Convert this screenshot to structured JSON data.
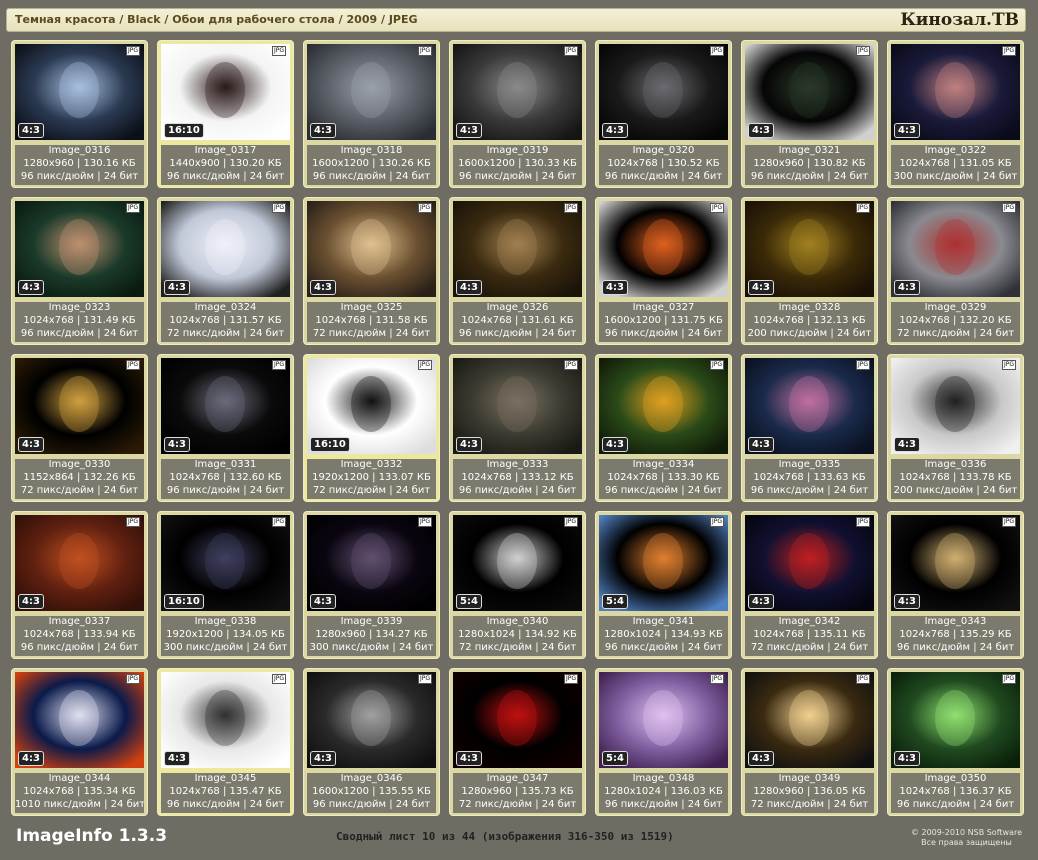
{
  "breadcrumb": "Темная красота / Black / Обои для рабочего стола / 2009 / JPEG",
  "brand": "Кинозал.ТВ",
  "format_badge": "JPG",
  "footer": {
    "app_name": "ImageInfo 1.3.3",
    "summary": "Сводный лист 10 из 44 (изображения 316-350 из 1519)",
    "copyright": "© 2009-2010 NSB Software",
    "rights": "Все права защищены"
  },
  "thumbnails": [
    {
      "name": "Image_0316",
      "ratio": "4:3",
      "dims": "1280x960 | 130.16 КБ",
      "meta": "96 пикс/дюйм | 24 бит",
      "colors": [
        "#2b3a52",
        "#a8c0e0",
        "#0a0f18"
      ]
    },
    {
      "name": "Image_0317",
      "ratio": "16:10",
      "dims": "1440x900 | 130.20 КБ",
      "meta": "96 пикс/дюйм | 24 бит",
      "colors": [
        "#f4f4f4",
        "#2a1a1a",
        "#ffffff"
      ],
      "selected": true
    },
    {
      "name": "Image_0318",
      "ratio": "4:3",
      "dims": "1600x1200 | 130.26 КБ",
      "meta": "96 пикс/дюйм | 24 бит",
      "colors": [
        "#5a5e66",
        "#9aa0a8",
        "#2a2d33"
      ]
    },
    {
      "name": "Image_0319",
      "ratio": "4:3",
      "dims": "1600x1200 | 130.33 КБ",
      "meta": "96 пикс/дюйм | 24 бит",
      "colors": [
        "#3a3a3a",
        "#8a8a8a",
        "#151515"
      ]
    },
    {
      "name": "Image_0320",
      "ratio": "4:3",
      "dims": "1024x768 | 130.52 КБ",
      "meta": "96 пикс/дюйм | 24 бит",
      "colors": [
        "#1a1a1a",
        "#6a6a70",
        "#050505"
      ]
    },
    {
      "name": "Image_0321",
      "ratio": "4:3",
      "dims": "1280x960 | 130.82 КБ",
      "meta": "96 пикс/дюйм | 24 бит",
      "colors": [
        "#050505",
        "#2a3a2a",
        "#d0d0d0"
      ]
    },
    {
      "name": "Image_0322",
      "ratio": "4:3",
      "dims": "1024x768 | 131.05 КБ",
      "meta": "300 пикс/дюйм | 24 бит",
      "colors": [
        "#1a1a3a",
        "#c08080",
        "#0a0a1a"
      ]
    },
    {
      "name": "Image_0323",
      "ratio": "4:3",
      "dims": "1024x768 | 131.49 КБ",
      "meta": "96 пикс/дюйм | 24 бит",
      "colors": [
        "#1a3a2a",
        "#c09070",
        "#0a1a10"
      ]
    },
    {
      "name": "Image_0324",
      "ratio": "4:3",
      "dims": "1024x768 | 131.57 КБ",
      "meta": "72 пикс/дюйм | 24 бит",
      "colors": [
        "#c0c8d8",
        "#f0f0f8",
        "#202020"
      ]
    },
    {
      "name": "Image_0325",
      "ratio": "4:3",
      "dims": "1024x768 | 131.58 КБ",
      "meta": "72 пикс/дюйм | 24 бит",
      "colors": [
        "#6a5030",
        "#e0c090",
        "#2a2018"
      ]
    },
    {
      "name": "Image_0326",
      "ratio": "4:3",
      "dims": "1024x768 | 131.61 КБ",
      "meta": "96 пикс/дюйм | 24 бит",
      "colors": [
        "#3a2a10",
        "#a08050",
        "#1a1408"
      ]
    },
    {
      "name": "Image_0327",
      "ratio": "4:3",
      "dims": "1600x1200 | 131.75 КБ",
      "meta": "96 пикс/дюйм | 24 бит",
      "colors": [
        "#000000",
        "#e06020",
        "#d0d0d0"
      ]
    },
    {
      "name": "Image_0328",
      "ratio": "4:3",
      "dims": "1024x768 | 132.13 КБ",
      "meta": "200 пикс/дюйм | 24 бит",
      "colors": [
        "#3a2a08",
        "#a08020",
        "#1a1005"
      ]
    },
    {
      "name": "Image_0329",
      "ratio": "4:3",
      "dims": "1024x768 | 132.20 КБ",
      "meta": "72 пикс/дюйм | 24 бит",
      "colors": [
        "#8a8a90",
        "#b03030",
        "#303038"
      ]
    },
    {
      "name": "Image_0330",
      "ratio": "4:3",
      "dims": "1152x864 | 132.26 КБ",
      "meta": "72 пикс/дюйм | 24 бит",
      "colors": [
        "#000000",
        "#d0a040",
        "#2a1a05"
      ]
    },
    {
      "name": "Image_0331",
      "ratio": "4:3",
      "dims": "1024x768 | 132.60 КБ",
      "meta": "96 пикс/дюйм | 24 бит",
      "colors": [
        "#0a0a0a",
        "#6a6a7a",
        "#000000"
      ]
    },
    {
      "name": "Image_0332",
      "ratio": "16:10",
      "dims": "1920x1200 | 133.07 КБ",
      "meta": "72 пикс/дюйм | 24 бит",
      "colors": [
        "#ffffff",
        "#111111",
        "#dddddd"
      ],
      "selected": true
    },
    {
      "name": "Image_0333",
      "ratio": "4:3",
      "dims": "1024x768 | 133.12 КБ",
      "meta": "96 пикс/дюйм | 24 бит",
      "colors": [
        "#3a3a30",
        "#7a7060",
        "#1a1a15"
      ]
    },
    {
      "name": "Image_0334",
      "ratio": "4:3",
      "dims": "1024x768 | 133.30 КБ",
      "meta": "96 пикс/дюйм | 24 бит",
      "colors": [
        "#2a4a18",
        "#e0a020",
        "#101a08"
      ]
    },
    {
      "name": "Image_0335",
      "ratio": "4:3",
      "dims": "1024x768 | 133.63 КБ",
      "meta": "96 пикс/дюйм | 24 бит",
      "colors": [
        "#1a2a4a",
        "#c070a0",
        "#0a1020"
      ]
    },
    {
      "name": "Image_0336",
      "ratio": "4:3",
      "dims": "1024x768 | 133.78 КБ",
      "meta": "200 пикс/дюйм | 24 бит",
      "colors": [
        "#c8c8c8",
        "#202020",
        "#f0f0f0"
      ]
    },
    {
      "name": "Image_0337",
      "ratio": "4:3",
      "dims": "1024x768 | 133.94 КБ",
      "meta": "96 пикс/дюйм | 24 бит",
      "colors": [
        "#602010",
        "#c05020",
        "#301008"
      ]
    },
    {
      "name": "Image_0338",
      "ratio": "16:10",
      "dims": "1920x1200 | 134.05 КБ",
      "meta": "300 пикс/дюйм | 24 бит",
      "colors": [
        "#000000",
        "#404060",
        "#101010"
      ]
    },
    {
      "name": "Image_0339",
      "ratio": "4:3",
      "dims": "1280x960 | 134.27 КБ",
      "meta": "300 пикс/дюйм | 24 бит",
      "colors": [
        "#0a0510",
        "#605070",
        "#000000"
      ]
    },
    {
      "name": "Image_0340",
      "ratio": "5:4",
      "dims": "1280x1024 | 134.92 КБ",
      "meta": "72 пикс/дюйм | 24 бит",
      "colors": [
        "#000000",
        "#d0d0d0",
        "#0a0a0a"
      ]
    },
    {
      "name": "Image_0341",
      "ratio": "5:4",
      "dims": "1280x1024 | 134.93 КБ",
      "meta": "96 пикс/дюйм | 24 бит",
      "colors": [
        "#000000",
        "#e08030",
        "#5080c0"
      ]
    },
    {
      "name": "Image_0342",
      "ratio": "4:3",
      "dims": "1024x768 | 135.11 КБ",
      "meta": "72 пикс/дюйм | 24 бит",
      "colors": [
        "#101030",
        "#c02020",
        "#050510"
      ]
    },
    {
      "name": "Image_0343",
      "ratio": "4:3",
      "dims": "1024x768 | 135.29 КБ",
      "meta": "96 пикс/дюйм | 24 бит",
      "colors": [
        "#000000",
        "#d0b070",
        "#101010"
      ]
    },
    {
      "name": "Image_0344",
      "ratio": "4:3",
      "dims": "1024x768 | 135.34 КБ",
      "meta": "1010 пикс/дюйм | 24 бит",
      "colors": [
        "#0a1a4a",
        "#e0e0f0",
        "#d04010"
      ]
    },
    {
      "name": "Image_0345",
      "ratio": "4:3",
      "dims": "1024x768 | 135.47 КБ",
      "meta": "96 пикс/дюйм | 24 бит",
      "colors": [
        "#e8e8e8",
        "#303030",
        "#ffffff"
      ],
      "selected": true
    },
    {
      "name": "Image_0346",
      "ratio": "4:3",
      "dims": "1600x1200 | 135.55 КБ",
      "meta": "96 пикс/дюйм | 24 бит",
      "colors": [
        "#2a2a2a",
        "#a0a0a0",
        "#101010"
      ]
    },
    {
      "name": "Image_0347",
      "ratio": "4:3",
      "dims": "1280x960 | 135.73 КБ",
      "meta": "72 пикс/дюйм | 24 бит",
      "colors": [
        "#000000",
        "#c01010",
        "#100000"
      ]
    },
    {
      "name": "Image_0348",
      "ratio": "5:4",
      "dims": "1280x1024 | 136.03 КБ",
      "meta": "96 пикс/дюйм | 24 бит",
      "colors": [
        "#8060a0",
        "#e0c0f0",
        "#402050"
      ]
    },
    {
      "name": "Image_0349",
      "ratio": "4:3",
      "dims": "1280x960 | 136.05 КБ",
      "meta": "72 пикс/дюйм | 24 бит",
      "colors": [
        "#3a2a10",
        "#f0d090",
        "#101010"
      ]
    },
    {
      "name": "Image_0350",
      "ratio": "4:3",
      "dims": "1024x768 | 136.37 КБ",
      "meta": "96 пикс/дюйм | 24 бит",
      "colors": [
        "#204a20",
        "#90e070",
        "#0a200a"
      ]
    }
  ]
}
